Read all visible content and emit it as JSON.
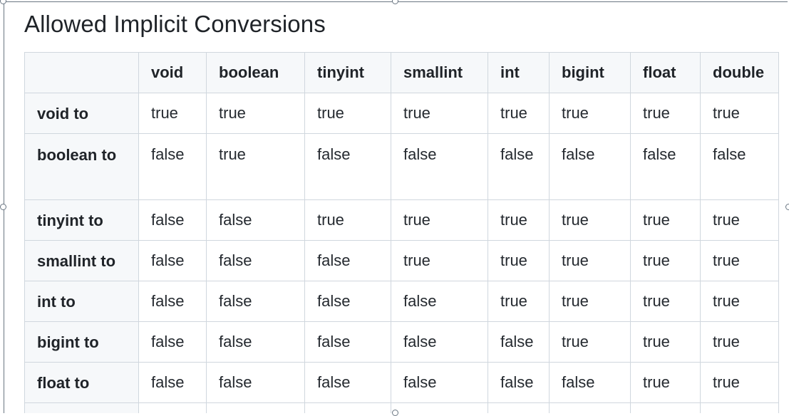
{
  "heading": "Allowed Implicit Conversions",
  "table": {
    "corner": "",
    "columns": [
      "void",
      "boolean",
      "tinyint",
      "smallint",
      "int",
      "bigint",
      "float",
      "double"
    ],
    "rows": [
      {
        "label": "void to",
        "cells": [
          "true",
          "true",
          "true",
          "true",
          "true",
          "true",
          "true",
          "true"
        ]
      },
      {
        "label": "boolean to",
        "cells": [
          "false",
          "true",
          "false",
          "false",
          "false",
          "false",
          "false",
          "false"
        ]
      },
      {
        "label": "tinyint to",
        "cells": [
          "false",
          "false",
          "true",
          "true",
          "true",
          "true",
          "true",
          "true"
        ]
      },
      {
        "label": "smallint to",
        "cells": [
          "false",
          "false",
          "false",
          "true",
          "true",
          "true",
          "true",
          "true"
        ]
      },
      {
        "label": "int to",
        "cells": [
          "false",
          "false",
          "false",
          "false",
          "true",
          "true",
          "true",
          "true"
        ]
      },
      {
        "label": "bigint to",
        "cells": [
          "false",
          "false",
          "false",
          "false",
          "false",
          "true",
          "true",
          "true"
        ]
      },
      {
        "label": "float to",
        "cells": [
          "false",
          "false",
          "false",
          "false",
          "false",
          "false",
          "true",
          "true"
        ]
      }
    ]
  }
}
